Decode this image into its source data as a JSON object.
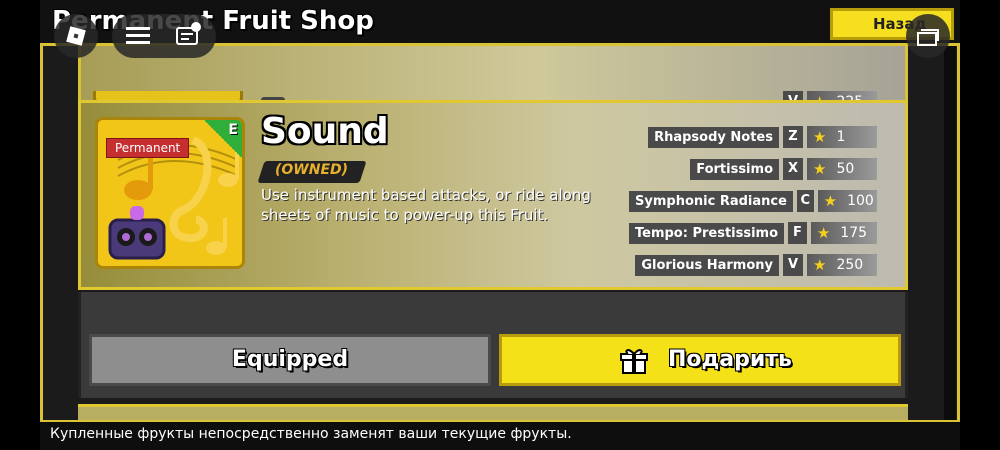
{
  "shop": {
    "title": "Permanent Fruit Shop",
    "back_label": "Назад"
  },
  "previous_card": {
    "move_key": "V",
    "move_cost": "225"
  },
  "fruit": {
    "name": "Sound",
    "badge": "Permanent",
    "rarity_letter": "E",
    "status": "(OWNED)",
    "description": "Use instrument based attacks, or ride along sheets of music to power-up this Fruit.",
    "moves": [
      {
        "name": "Rhapsody Notes",
        "key": "Z",
        "cost": "1"
      },
      {
        "name": "Fortissimo",
        "key": "X",
        "cost": "50"
      },
      {
        "name": "Symphonic Radiance",
        "key": "C",
        "cost": "100"
      },
      {
        "name": "Tempo: Prestissimo",
        "key": "F",
        "cost": "175"
      },
      {
        "name": "Glorious Harmony",
        "key": "V",
        "cost": "250"
      }
    ]
  },
  "actions": {
    "equipped_label": "Equipped",
    "gift_label": "Подарить"
  },
  "footer": {
    "notice": "Купленные фрукты непосредственно заменят ваши текущие фрукты."
  },
  "colors": {
    "accent_gold": "#d9c334",
    "gift_yellow": "#f4e117",
    "permanent_red": "#c62f2f",
    "rarity_green": "#2fae3a"
  }
}
